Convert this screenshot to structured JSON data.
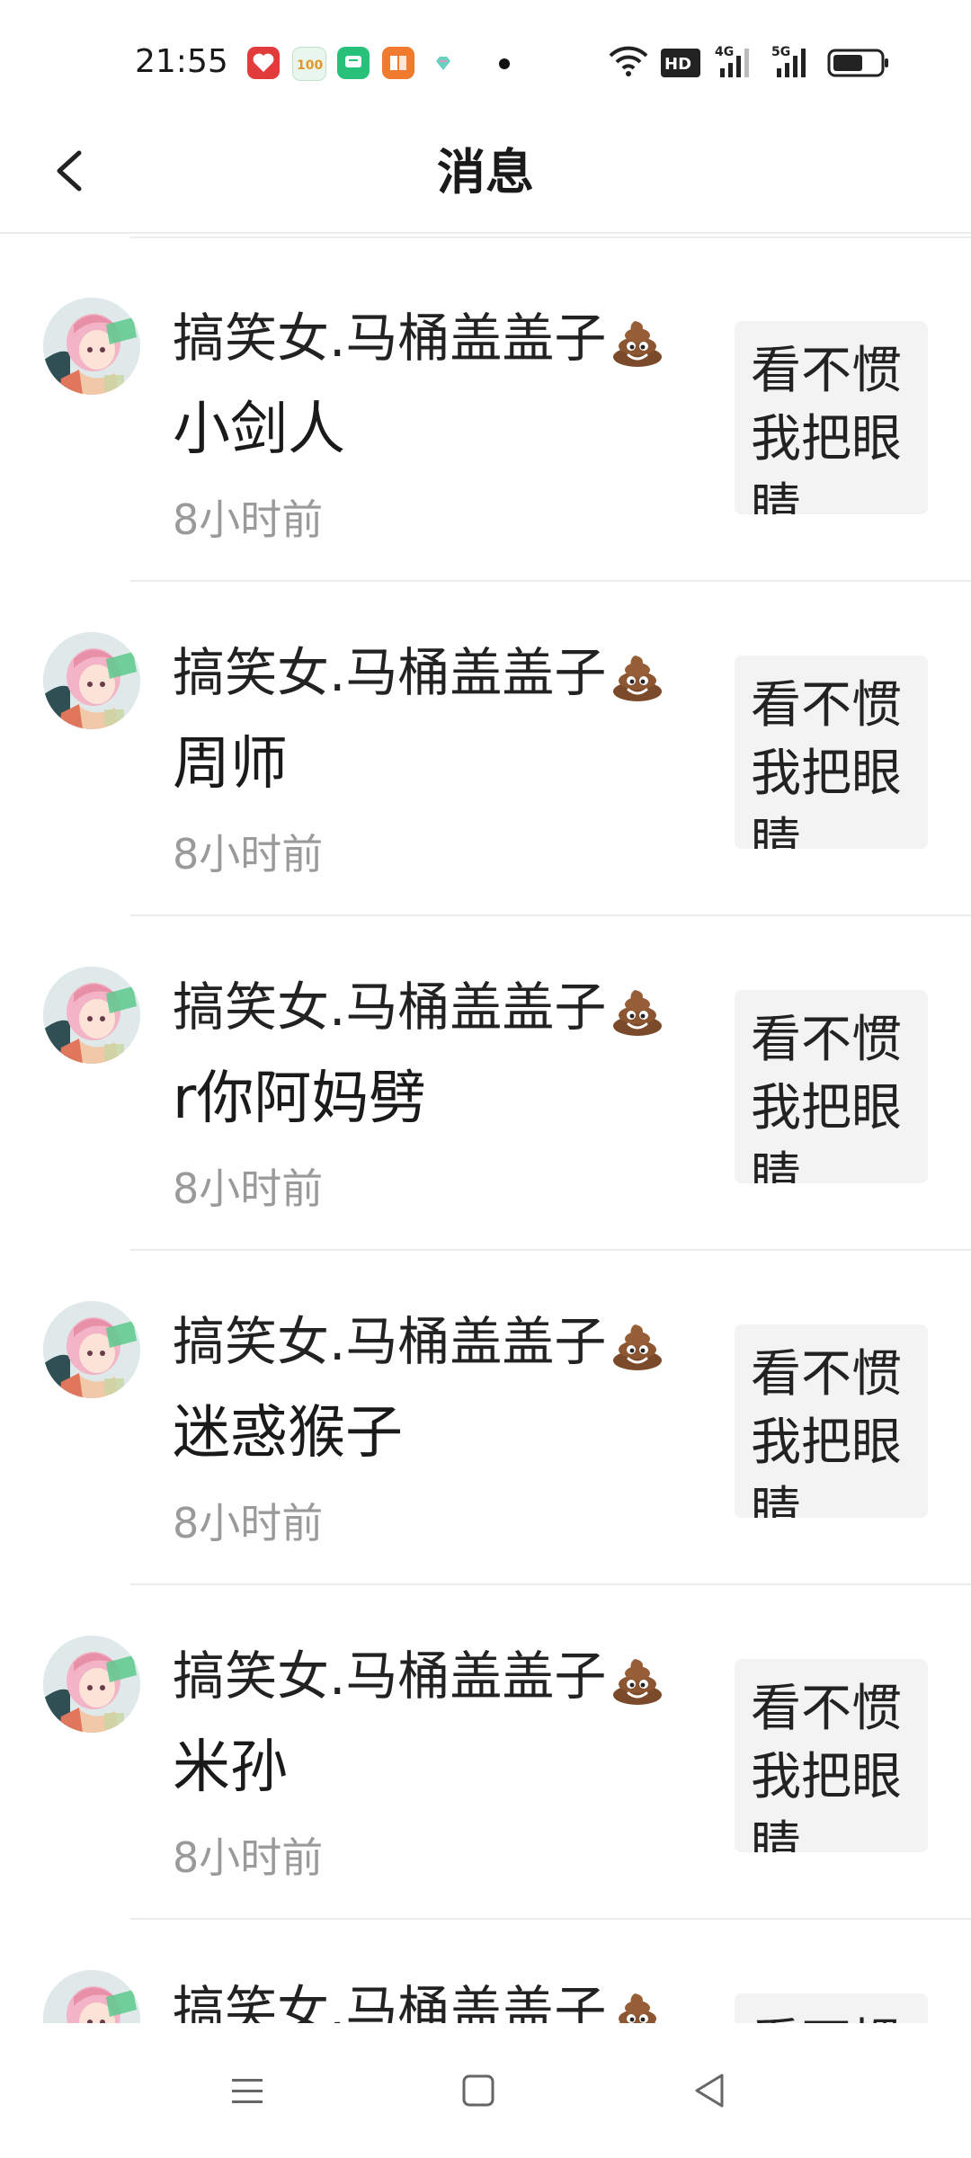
{
  "status_bar": {
    "time": "21:55",
    "app_icons": [
      "heart-app-icon",
      "hundred-app-icon",
      "chat-app-icon",
      "book-app-icon",
      "diamond-app-icon"
    ],
    "icon_colors": [
      "#e23b3b",
      "#e8f6ee",
      "#27c17a",
      "#f07a2d",
      "#ffffff"
    ],
    "indicators": [
      "notification-dot",
      "wifi-icon",
      "hd-icon",
      "signal-4g-icon",
      "signal-5g-icon",
      "battery-icon"
    ]
  },
  "header": {
    "back_icon": "chevron-left-icon",
    "title": "消息"
  },
  "messages": [
    {
      "user": "搞笑女.马桶盖盖子",
      "text": "小剑人",
      "time": "8小时前",
      "preview": "看不惯我把眼睛"
    },
    {
      "user": "搞笑女.马桶盖盖子",
      "text": "周师",
      "time": "8小时前",
      "preview": "看不惯我把眼睛"
    },
    {
      "user": "搞笑女.马桶盖盖子",
      "text": "r你阿妈劈",
      "time": "8小时前",
      "preview": "看不惯我把眼睛"
    },
    {
      "user": "搞笑女.马桶盖盖子",
      "text": "迷惑猴子",
      "time": "8小时前",
      "preview": "看不惯我把眼睛"
    },
    {
      "user": "搞笑女.马桶盖盖子",
      "text": "米孙",
      "time": "8小时前",
      "preview": "看不惯我把眼睛"
    },
    {
      "user": "搞笑女.马桶盖盖子",
      "text": "",
      "time": "",
      "preview": "看不惯"
    }
  ],
  "nav_bar": {
    "icons": [
      "menu-icon",
      "home-square-icon",
      "back-triangle-icon"
    ]
  },
  "colors": {
    "divider": "#ececec",
    "time_text": "#9a9a9a",
    "preview_bg": "#f3f3f3"
  }
}
